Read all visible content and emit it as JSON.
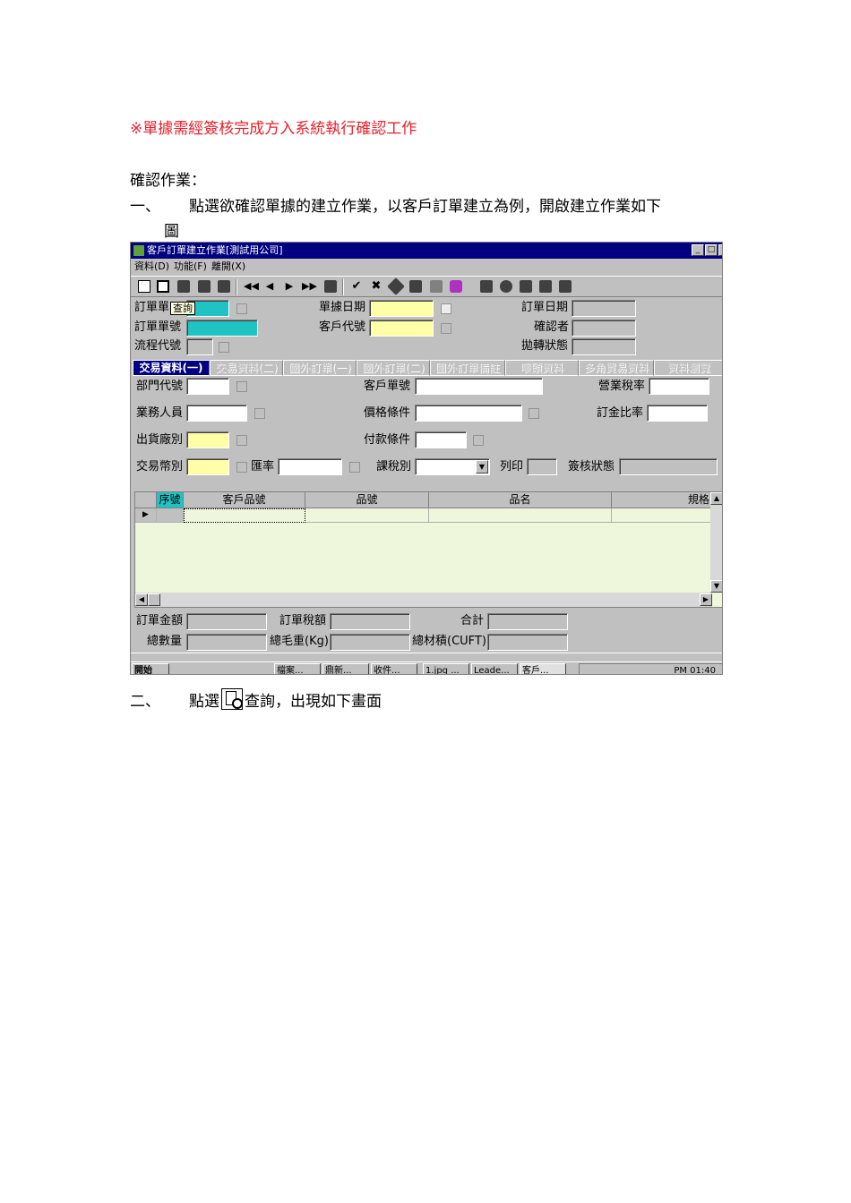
{
  "note": "※單據需經簽核完成方入系統執行確認工作",
  "heading": "確認作業：",
  "step1": {
    "number": "一、",
    "text": "點選欲確認單據的建立作業，以客戶訂單建立為例，開啟建立作業如下",
    "text_cont": "圖"
  },
  "step2": {
    "number": "二、",
    "text_before": "點選",
    "icon": "query-icon",
    "text_after": "查詢，出現如下畫面"
  },
  "window": {
    "title": "客戶訂單建立作業[測試用公司]",
    "controls": [
      "_",
      "□",
      "×"
    ],
    "menu": [
      "資料(D)",
      "功能(F)",
      "離開(X)"
    ],
    "tooltip": "查詢",
    "header_fields": {
      "order_type_label": "訂單單",
      "order_no_label": "訂單單號",
      "flow_code_label": "流程代號",
      "doc_date_label": "單據日期",
      "customer_code_label": "客戶代號",
      "order_date_label": "訂單日期",
      "confirmer_label": "確認者",
      "transfer_status_label": "拋轉狀態"
    },
    "tabs": [
      "交易資料(一)",
      "交易資料(二)",
      "國外訂單(一)",
      "國外訂單(二)",
      "國外訂單備註",
      "嘜頭資料",
      "多角貿易資料",
      "資料瀏覽"
    ],
    "detail_fields": {
      "dept_label": "部門代號",
      "customer_order_label": "客戶單號",
      "tax_rate_label": "營業稅率",
      "sales_label": "業務人員",
      "price_terms_label": "價格條件",
      "deposit_label": "訂金比率",
      "warehouse_label": "出貨廠別",
      "payment_label": "付款條件",
      "currency_label": "交易幣別",
      "exchange_label": "匯率",
      "tax_type_label": "課稅別",
      "print_label": "列印",
      "approval_label": "簽核狀態"
    },
    "grid_columns": [
      "序號",
      "客戶品號",
      "品號",
      "品名",
      "規格"
    ],
    "totals": {
      "order_amount_label": "訂單金額",
      "order_tax_label": "訂單稅額",
      "total_label": "合計",
      "total_qty_label": "總數量",
      "gross_weight_label": "總毛重(Kg)",
      "volume_label": "總材積(CUFT)"
    },
    "taskbar": {
      "start": "開始",
      "tasks": [
        "檔案...",
        "鼎新...",
        "收件...",
        "1.jpg ...",
        "Leade...",
        "客戶..."
      ],
      "clock": "PM 01:40"
    }
  }
}
